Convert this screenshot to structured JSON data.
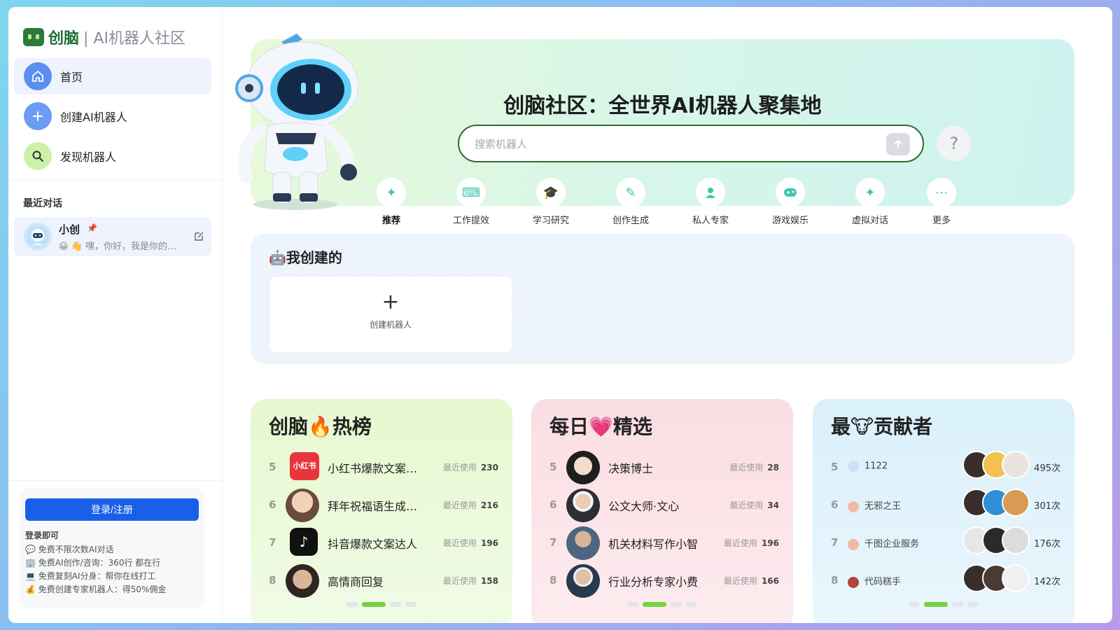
{
  "sidebar": {
    "brand": "创脑",
    "brand_sub": "| AI机器人社区",
    "nav": [
      {
        "label": "首页",
        "icon": "home-icon",
        "color": "#5b8ef0"
      },
      {
        "label": "创建AI机器人",
        "icon": "plus-icon",
        "color": "#6c9bf3"
      },
      {
        "label": "发现机器人",
        "icon": "search-icon",
        "color": "#b8ea8a"
      }
    ],
    "recent_title": "最近对话",
    "recent": {
      "name": "小创",
      "preview": "😀 👋 嘿，你好，我是你的…"
    },
    "login": {
      "button": "登录/注册",
      "hint": "登录即可",
      "perks": [
        "💬 免费不限次数AI对话",
        "🏢 免费AI创作/咨询：360行 都在行",
        "💻 免费复刻AI分身：帮你在线打工",
        "💰 免费创建专家机器人：得50%佣金"
      ]
    }
  },
  "hero": {
    "title": "创脑社区：全世界AI机器人聚集地",
    "search_placeholder": "搜索机器人",
    "help": "?",
    "categories": [
      {
        "label": "推荐",
        "icon": "sparkle-icon",
        "active": true
      },
      {
        "label": "工作提效",
        "icon": "keyboard-icon"
      },
      {
        "label": "学习研究",
        "icon": "graduation-cap-icon"
      },
      {
        "label": "创作生成",
        "icon": "pen-icon"
      },
      {
        "label": "私人专家",
        "icon": "person-icon"
      },
      {
        "label": "游戏娱乐",
        "icon": "gamepad-icon"
      },
      {
        "label": "虚拟对话",
        "icon": "sparkle-icon"
      },
      {
        "label": "更多",
        "icon": "more-icon"
      }
    ]
  },
  "mine": {
    "title": "🤖我创建的",
    "create_label": "创建机器人"
  },
  "hot": {
    "title": "创脑🔥热榜",
    "rows": [
      {
        "rank": "5",
        "name": "小红书爆款文案…",
        "usage_label": "最近使用",
        "usage": "230",
        "avatar": "#e8353b"
      },
      {
        "rank": "6",
        "name": "拜年祝福语生成…",
        "usage_label": "最近使用",
        "usage": "216",
        "avatar": "#c9a98e"
      },
      {
        "rank": "7",
        "name": "抖音爆款文案达人",
        "usage_label": "最近使用",
        "usage": "196",
        "avatar": "#111111"
      },
      {
        "rank": "8",
        "name": "高情商回复",
        "usage_label": "最近使用",
        "usage": "158",
        "avatar": "#5a4a42"
      }
    ]
  },
  "daily": {
    "title": "每日💗精选",
    "rows": [
      {
        "rank": "5",
        "name": "决策博士",
        "usage_label": "最近使用",
        "usage": "28",
        "avatar": "#2b2b2b"
      },
      {
        "rank": "6",
        "name": "公文大师·文心",
        "usage_label": "最近使用",
        "usage": "34",
        "avatar": "#3d3d46"
      },
      {
        "rank": "7",
        "name": "机关材料写作小智",
        "usage_label": "最近使用",
        "usage": "196",
        "avatar": "#5a6f86"
      },
      {
        "rank": "8",
        "name": "行业分析专家小费",
        "usage_label": "最近使用",
        "usage": "166",
        "avatar": "#2f4152"
      }
    ]
  },
  "contrib": {
    "title": "最🐮贡献者",
    "rows": [
      {
        "rank": "5",
        "user": "1122",
        "count": "495次",
        "mini": "#cfe0f5",
        "avs": [
          "#3a2e2a",
          "#f2c14e",
          "#e9e4e0"
        ]
      },
      {
        "rank": "6",
        "user": "无邪之王",
        "count": "301次",
        "mini": "#f0b9a4",
        "avs": [
          "#3a2e2a",
          "#2f8fd6",
          "#d99a55"
        ]
      },
      {
        "rank": "7",
        "user": "千图企业服务",
        "count": "176次",
        "mini": "#f0b9a4",
        "avs": [
          "#e6e6e6",
          "#2a2a2a",
          "#dcdcdc"
        ]
      },
      {
        "rank": "8",
        "user": "代码糕手",
        "count": "142次",
        "mini": "#b3433e",
        "avs": [
          "#3a2e2a",
          "#4a3a32",
          "#f0f0f0"
        ]
      }
    ]
  }
}
